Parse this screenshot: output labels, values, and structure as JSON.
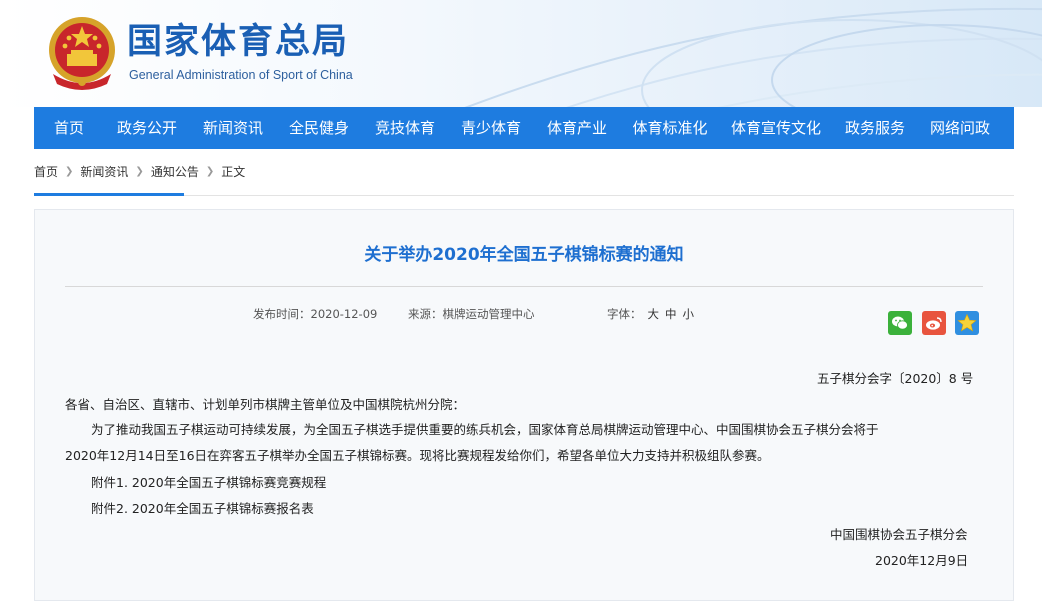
{
  "header": {
    "site_name": "国家体育总局",
    "site_name_en": "General Administration of Sport of China"
  },
  "nav": {
    "items": [
      "首页",
      "政务公开",
      "新闻资讯",
      "全民健身",
      "竞技体育",
      "青少体育",
      "体育产业",
      "体育标准化",
      "体育宣传文化",
      "政务服务",
      "网络问政"
    ]
  },
  "breadcrumb": {
    "items": [
      "首页",
      "新闻资讯",
      "通知公告",
      "正文"
    ]
  },
  "article": {
    "title": "关于举办2020年全国五子棋锦标赛的通知",
    "meta": {
      "publish_label": "发布时间：",
      "publish_date": "2020-12-09",
      "source_label": "来源：",
      "source": "棋牌运动管理中心",
      "font_label": "字体：",
      "font_sizes": [
        "大",
        "中",
        "小"
      ]
    },
    "doc_number": "五子棋分会字〔2020〕8 号",
    "salutation": "各省、自治区、直辖市、计划单列市棋牌主管单位及中国棋院杭州分院：",
    "paragraph_line1": "为了推动我国五子棋运动可持续发展，为全国五子棋选手提供重要的练兵机会，国家体育总局棋牌运动管理中心、中国围棋协会五子棋分会将于",
    "paragraph_line2": "2020年12月14日至16日在弈客五子棋举办全国五子棋锦标赛。现将比赛规程发给你们，希望各单位大力支持并积极组队参赛。",
    "attachment1": "附件1. 2020年全国五子棋锦标赛竞赛规程",
    "attachment2": "附件2. 2020年全国五子棋锦标赛报名表",
    "signature": "中国围棋协会五子棋分会",
    "signature_date": "2020年12月9日"
  },
  "share": {
    "icons": [
      "wechat-icon",
      "weibo-icon",
      "favorite-star-icon"
    ],
    "colors": {
      "wechat": "#3bb13b",
      "weibo": "#e8543e",
      "star": "#2f8fe0"
    }
  },
  "colors": {
    "brand": "#1e7ce0",
    "title": "#1e6fd0"
  }
}
